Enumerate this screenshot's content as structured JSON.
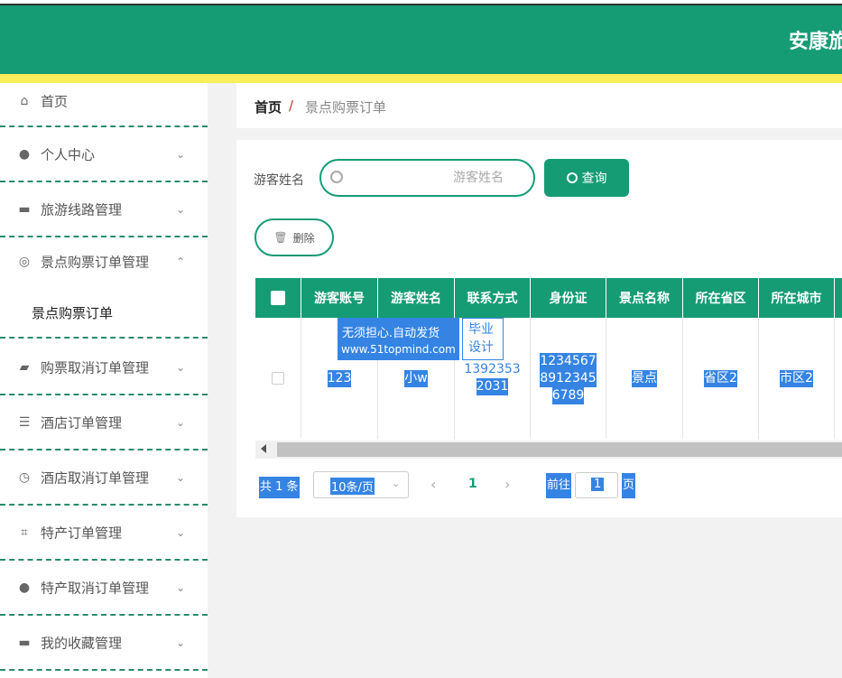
{
  "header": {
    "title": "安康旅"
  },
  "sidebar": {
    "items": [
      {
        "label": "首页",
        "icon": "home-icon",
        "glyph": "⌂",
        "chevron": ""
      },
      {
        "label": "个人中心",
        "icon": "user-icon",
        "glyph": "●",
        "chevron": "⌄"
      },
      {
        "label": "旅游线路管理",
        "icon": "briefcase-icon",
        "glyph": "▬",
        "chevron": "⌄"
      },
      {
        "label": "景点购票订单管理",
        "icon": "compass-icon",
        "glyph": "◎",
        "chevron": "⌃"
      },
      {
        "label": "购票取消订单管理",
        "icon": "wallet-icon",
        "glyph": "▰",
        "chevron": "⌄"
      },
      {
        "label": "酒店订单管理",
        "icon": "list-icon",
        "glyph": "☰",
        "chevron": "⌄"
      },
      {
        "label": "酒店取消订单管理",
        "icon": "clock-icon",
        "glyph": "◷",
        "chevron": "⌄"
      },
      {
        "label": "特产订单管理",
        "icon": "crop-icon",
        "glyph": "⌗",
        "chevron": "⌄"
      },
      {
        "label": "特产取消订单管理",
        "icon": "bulb-icon",
        "glyph": "●",
        "chevron": "⌄"
      },
      {
        "label": "我的收藏管理",
        "icon": "box-icon",
        "glyph": "▬",
        "chevron": "⌄"
      }
    ],
    "sub_item": "景点购票订单"
  },
  "breadcrumb": {
    "home": "首页",
    "separator": "/",
    "current": "景点购票订单"
  },
  "search": {
    "label": "游客姓名",
    "placeholder": "游客姓名",
    "button": "查询"
  },
  "actions": {
    "delete": "删除"
  },
  "table": {
    "columns": [
      "游客账号",
      "游客姓名",
      "联系方式",
      "身份证",
      "景点名称",
      "所在省区",
      "所在城市"
    ],
    "rows": [
      {
        "account": "123",
        "name": "小w",
        "phone": [
          "1392353",
          "2031"
        ],
        "id_card": [
          "1234567",
          "8912345",
          "6789"
        ],
        "spot": "景点",
        "province": "省区2",
        "city": "市区2"
      }
    ]
  },
  "watermark": {
    "line1": "无须担心.自动发货",
    "line2": "www.51topmind.com",
    "side1": "毕业",
    "side2": "设计"
  },
  "pager": {
    "total": "共 1 条",
    "page_size": "10条/页",
    "prev": "‹",
    "current": "1",
    "next": "›",
    "goto": "前往",
    "goto_value": "1",
    "page_suffix": "页"
  },
  "colors": {
    "primary": "#169c75",
    "accent_yellow": "#f8ee5a",
    "selection": "#3584e4"
  }
}
